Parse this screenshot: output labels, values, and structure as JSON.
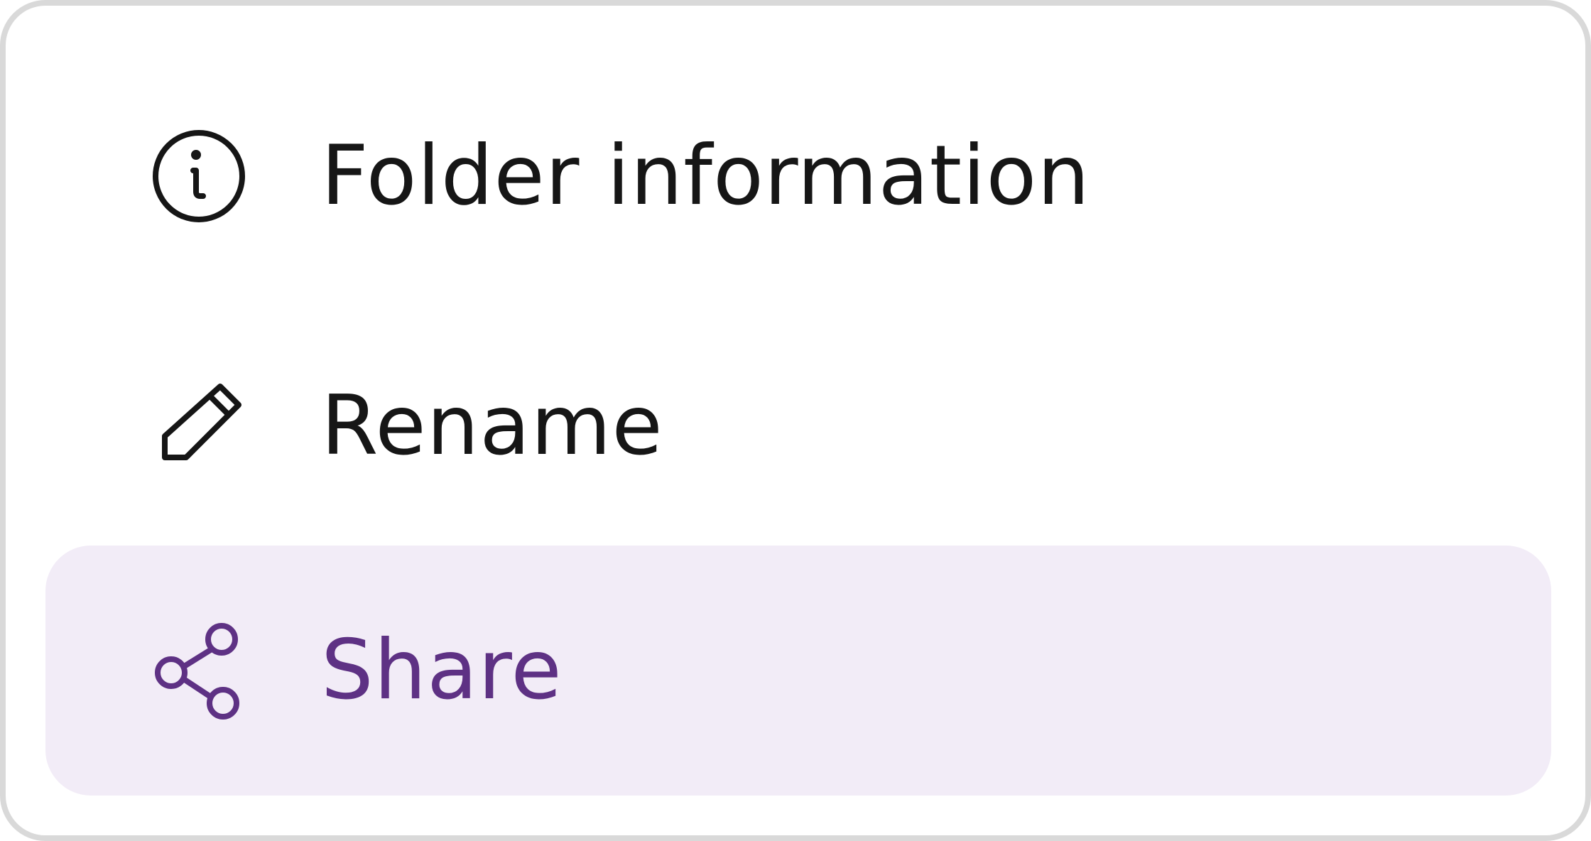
{
  "menu": {
    "items": [
      {
        "label": "Folder information",
        "icon": "info-icon",
        "selected": false
      },
      {
        "label": "Rename",
        "icon": "pencil-icon",
        "selected": false
      },
      {
        "label": "Share",
        "icon": "share-icon",
        "selected": true
      }
    ]
  },
  "colors": {
    "text": "#161616",
    "selected_text": "#5e3184",
    "selected_background": "#f2ecf7",
    "border": "#d9d9d9"
  }
}
